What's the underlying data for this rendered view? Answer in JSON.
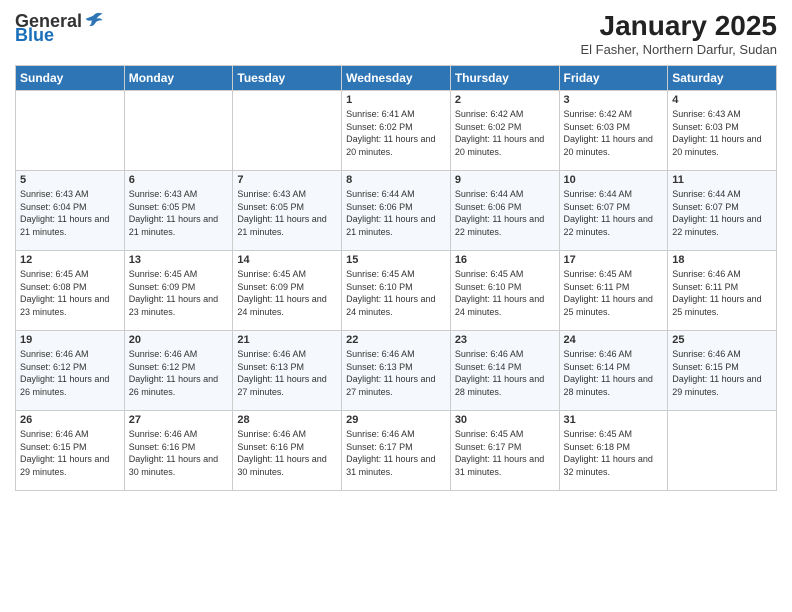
{
  "header": {
    "logo_general": "General",
    "logo_blue": "Blue",
    "title": "January 2025",
    "subtitle": "El Fasher, Northern Darfur, Sudan"
  },
  "weekdays": [
    "Sunday",
    "Monday",
    "Tuesday",
    "Wednesday",
    "Thursday",
    "Friday",
    "Saturday"
  ],
  "weeks": [
    [
      {
        "day": "",
        "info": ""
      },
      {
        "day": "",
        "info": ""
      },
      {
        "day": "",
        "info": ""
      },
      {
        "day": "1",
        "info": "Sunrise: 6:41 AM\nSunset: 6:02 PM\nDaylight: 11 hours and 20 minutes."
      },
      {
        "day": "2",
        "info": "Sunrise: 6:42 AM\nSunset: 6:02 PM\nDaylight: 11 hours and 20 minutes."
      },
      {
        "day": "3",
        "info": "Sunrise: 6:42 AM\nSunset: 6:03 PM\nDaylight: 11 hours and 20 minutes."
      },
      {
        "day": "4",
        "info": "Sunrise: 6:43 AM\nSunset: 6:03 PM\nDaylight: 11 hours and 20 minutes."
      }
    ],
    [
      {
        "day": "5",
        "info": "Sunrise: 6:43 AM\nSunset: 6:04 PM\nDaylight: 11 hours and 21 minutes."
      },
      {
        "day": "6",
        "info": "Sunrise: 6:43 AM\nSunset: 6:05 PM\nDaylight: 11 hours and 21 minutes."
      },
      {
        "day": "7",
        "info": "Sunrise: 6:43 AM\nSunset: 6:05 PM\nDaylight: 11 hours and 21 minutes."
      },
      {
        "day": "8",
        "info": "Sunrise: 6:44 AM\nSunset: 6:06 PM\nDaylight: 11 hours and 21 minutes."
      },
      {
        "day": "9",
        "info": "Sunrise: 6:44 AM\nSunset: 6:06 PM\nDaylight: 11 hours and 22 minutes."
      },
      {
        "day": "10",
        "info": "Sunrise: 6:44 AM\nSunset: 6:07 PM\nDaylight: 11 hours and 22 minutes."
      },
      {
        "day": "11",
        "info": "Sunrise: 6:44 AM\nSunset: 6:07 PM\nDaylight: 11 hours and 22 minutes."
      }
    ],
    [
      {
        "day": "12",
        "info": "Sunrise: 6:45 AM\nSunset: 6:08 PM\nDaylight: 11 hours and 23 minutes."
      },
      {
        "day": "13",
        "info": "Sunrise: 6:45 AM\nSunset: 6:09 PM\nDaylight: 11 hours and 23 minutes."
      },
      {
        "day": "14",
        "info": "Sunrise: 6:45 AM\nSunset: 6:09 PM\nDaylight: 11 hours and 24 minutes."
      },
      {
        "day": "15",
        "info": "Sunrise: 6:45 AM\nSunset: 6:10 PM\nDaylight: 11 hours and 24 minutes."
      },
      {
        "day": "16",
        "info": "Sunrise: 6:45 AM\nSunset: 6:10 PM\nDaylight: 11 hours and 24 minutes."
      },
      {
        "day": "17",
        "info": "Sunrise: 6:45 AM\nSunset: 6:11 PM\nDaylight: 11 hours and 25 minutes."
      },
      {
        "day": "18",
        "info": "Sunrise: 6:46 AM\nSunset: 6:11 PM\nDaylight: 11 hours and 25 minutes."
      }
    ],
    [
      {
        "day": "19",
        "info": "Sunrise: 6:46 AM\nSunset: 6:12 PM\nDaylight: 11 hours and 26 minutes."
      },
      {
        "day": "20",
        "info": "Sunrise: 6:46 AM\nSunset: 6:12 PM\nDaylight: 11 hours and 26 minutes."
      },
      {
        "day": "21",
        "info": "Sunrise: 6:46 AM\nSunset: 6:13 PM\nDaylight: 11 hours and 27 minutes."
      },
      {
        "day": "22",
        "info": "Sunrise: 6:46 AM\nSunset: 6:13 PM\nDaylight: 11 hours and 27 minutes."
      },
      {
        "day": "23",
        "info": "Sunrise: 6:46 AM\nSunset: 6:14 PM\nDaylight: 11 hours and 28 minutes."
      },
      {
        "day": "24",
        "info": "Sunrise: 6:46 AM\nSunset: 6:14 PM\nDaylight: 11 hours and 28 minutes."
      },
      {
        "day": "25",
        "info": "Sunrise: 6:46 AM\nSunset: 6:15 PM\nDaylight: 11 hours and 29 minutes."
      }
    ],
    [
      {
        "day": "26",
        "info": "Sunrise: 6:46 AM\nSunset: 6:15 PM\nDaylight: 11 hours and 29 minutes."
      },
      {
        "day": "27",
        "info": "Sunrise: 6:46 AM\nSunset: 6:16 PM\nDaylight: 11 hours and 30 minutes."
      },
      {
        "day": "28",
        "info": "Sunrise: 6:46 AM\nSunset: 6:16 PM\nDaylight: 11 hours and 30 minutes."
      },
      {
        "day": "29",
        "info": "Sunrise: 6:46 AM\nSunset: 6:17 PM\nDaylight: 11 hours and 31 minutes."
      },
      {
        "day": "30",
        "info": "Sunrise: 6:45 AM\nSunset: 6:17 PM\nDaylight: 11 hours and 31 minutes."
      },
      {
        "day": "31",
        "info": "Sunrise: 6:45 AM\nSunset: 6:18 PM\nDaylight: 11 hours and 32 minutes."
      },
      {
        "day": "",
        "info": ""
      }
    ]
  ]
}
